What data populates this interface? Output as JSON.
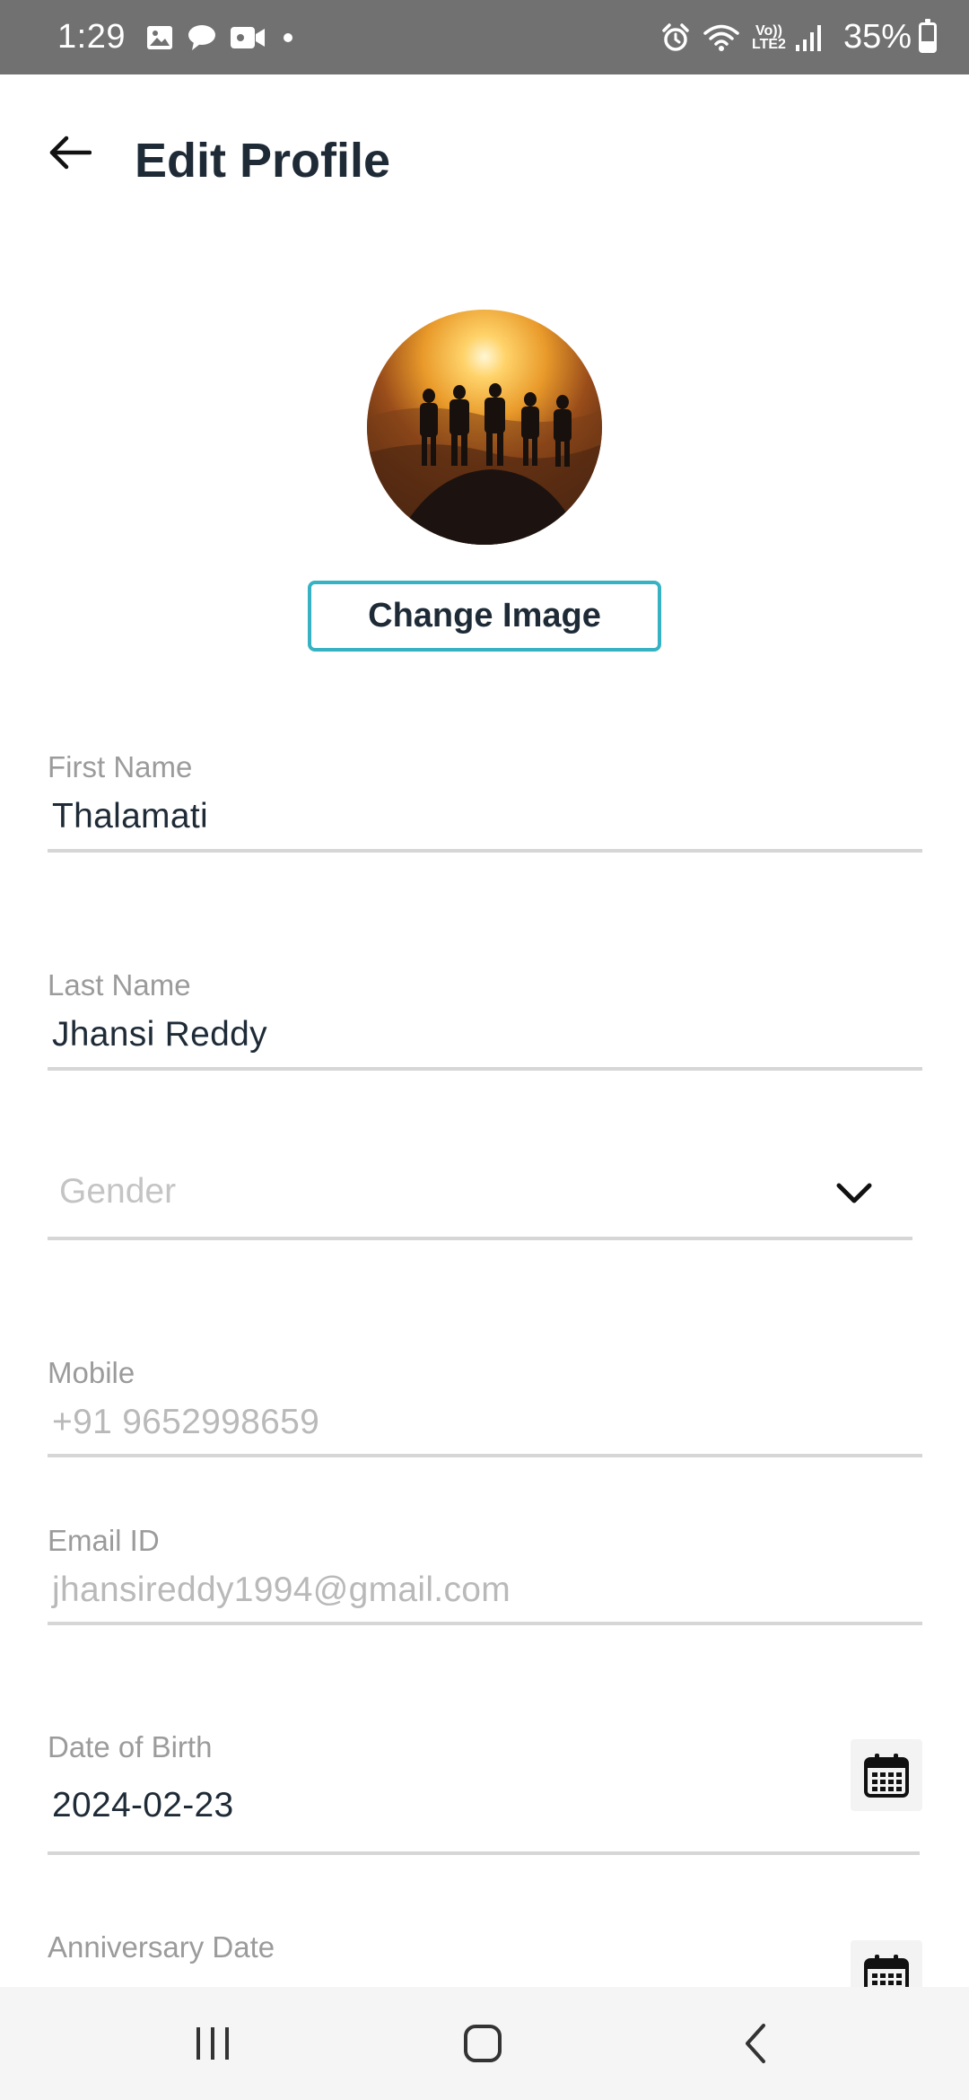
{
  "status_bar": {
    "time": "1:29",
    "network_label_top": "Vo))",
    "network_label_bottom": "LTE2",
    "battery_percent": "35%",
    "battery_level": 0.35,
    "icons": [
      "gallery-icon",
      "chat-icon",
      "video-icon",
      "alarm-icon",
      "wifi-icon",
      "signal-icon",
      "battery-icon"
    ]
  },
  "header": {
    "title": "Edit Profile",
    "back_icon": "arrow-left-icon"
  },
  "profile": {
    "change_image_label": "Change Image"
  },
  "form": {
    "first_name": {
      "label": "First Name",
      "value": "Thalamati"
    },
    "last_name": {
      "label": "Last Name",
      "value": "Jhansi Reddy"
    },
    "gender": {
      "placeholder": "Gender",
      "icon": "chevron-down-icon"
    },
    "mobile": {
      "label": "Mobile",
      "value": "+91 9652998659"
    },
    "email": {
      "label": "Email ID",
      "value": "jhansireddy1994@gmail.com"
    },
    "dob": {
      "label": "Date of Birth",
      "value": "2024-02-23",
      "icon": "calendar-icon"
    },
    "anniversary": {
      "label": "Anniversary Date",
      "icon": "calendar-icon"
    }
  },
  "nav_bar": {
    "icons": [
      "recent-apps-icon",
      "home-icon",
      "back-icon"
    ]
  },
  "colors": {
    "accent": "#37b2c3",
    "status_bar": "#717171",
    "title_text": "#1e2b37",
    "label_text": "#9b9b9b",
    "underline": "#d6d6d6"
  }
}
